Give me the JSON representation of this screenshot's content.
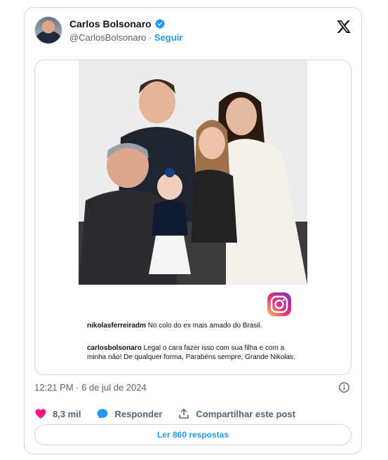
{
  "author": {
    "name": "Carlos Bolsonaro",
    "handle": "@CarlosBolsonaro",
    "separator": "·",
    "follow_label": "Seguir",
    "verified_icon": "verified-badge-icon",
    "verified_color": "#1d9bf0"
  },
  "platform_icon": "x-logo-icon",
  "media": {
    "instagram_icon": "instagram-icon",
    "comments": [
      {
        "user": "nikolasferreiradm",
        "text": "No colo do ex mais amado do Brasil."
      },
      {
        "user": "carlosbolsonaro",
        "text": "Legal o cara fazer isso com sua filha e com a minha não! De qualquer forma, Parabéns sempre, Grande Nikolas."
      }
    ]
  },
  "timestamp": "12:21 PM · 6 de jul de 2024",
  "actions": {
    "likes": "8,3 mil",
    "reply_label": "Responder",
    "share_label": "Compartilhar este post",
    "like_color": "#f91880",
    "reply_color": "#1d9bf0"
  },
  "read_replies_label": "Ler 860 respostas",
  "colors": {
    "accent": "#1d9bf0",
    "muted": "#536471",
    "border": "#cfd9de"
  }
}
